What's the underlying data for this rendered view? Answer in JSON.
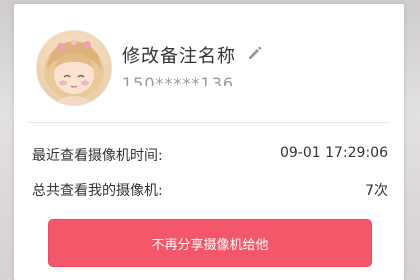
{
  "profile": {
    "name": "修改备注名称",
    "phone": "150*****136"
  },
  "stats": {
    "last_view_label": "最近查看摄像机时间:",
    "last_view_value": "09-01 17:29:06",
    "total_views_label": "总共查看我的摄像机:",
    "total_views_value": "7次"
  },
  "actions": {
    "stop_sharing_label": "不再分享摄像机给他"
  },
  "icons": {
    "edit": "pencil-icon",
    "avatar": "cartoon-girl-avatar"
  },
  "colors": {
    "button_bg": "#f4566a",
    "button_text": "#ffffff",
    "text_primary": "#333333",
    "text_secondary": "#9a9a9a"
  }
}
